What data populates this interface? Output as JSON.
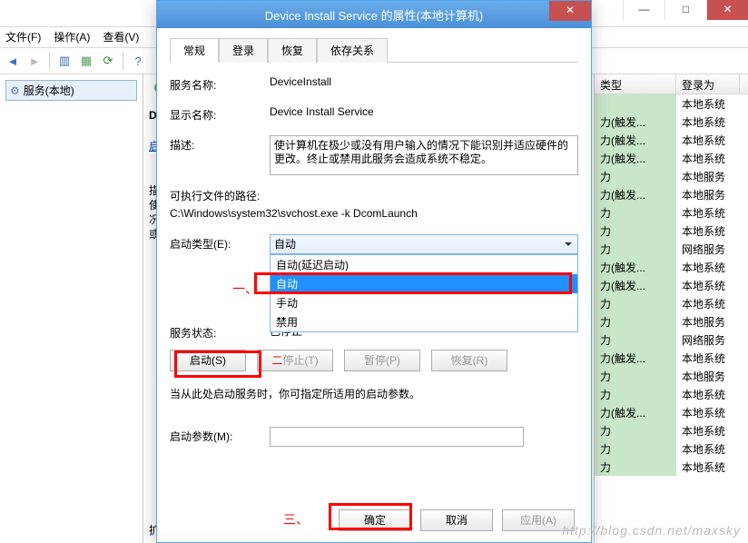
{
  "bg": {
    "menu": [
      "文件(F)",
      "操作(A)",
      "查看(V)"
    ],
    "tree_item": "服务(本地)",
    "detail": {
      "title_prefix": "Devi",
      "start_link": "启动",
      "desc_lines": [
        "描述:",
        "使计",
        "况下",
        "或禁"
      ],
      "tabs": "扩展"
    },
    "list_head": {
      "col1": "类型",
      "col2": "登录为"
    },
    "rows": [
      {
        "t": "",
        "a": "本地系统"
      },
      {
        "t": "力(触发...",
        "a": "本地系统"
      },
      {
        "t": "力(触发...",
        "a": "本地系统"
      },
      {
        "t": "力(触发...",
        "a": "本地系统"
      },
      {
        "t": "力",
        "a": "本地服务"
      },
      {
        "t": "力(触发...",
        "a": "本地服务"
      },
      {
        "t": "力",
        "a": "本地系统"
      },
      {
        "t": "力",
        "a": "本地系统"
      },
      {
        "t": "力",
        "a": "网络服务"
      },
      {
        "t": "力(触发...",
        "a": "本地系统"
      },
      {
        "t": "力(触发...",
        "a": "本地系统"
      },
      {
        "t": "力",
        "a": "本地系统"
      },
      {
        "t": "力",
        "a": "本地服务"
      },
      {
        "t": "力",
        "a": "网络服务"
      },
      {
        "t": "力(触发...",
        "a": "本地系统"
      },
      {
        "t": "力",
        "a": "本地服务"
      },
      {
        "t": "力",
        "a": "本地系统"
      },
      {
        "t": "力(触发...",
        "a": "本地系统"
      },
      {
        "t": "力",
        "a": "本地系统"
      },
      {
        "t": "力",
        "a": "本地系统"
      },
      {
        "t": "力",
        "a": "本地系统"
      }
    ]
  },
  "dlg": {
    "title": "Device Install Service 的属性(本地计算机)",
    "tabs": {
      "general": "常规",
      "logon": "登录",
      "recovery": "恢复",
      "deps": "依存关系"
    },
    "labels": {
      "svc_name": "服务名称:",
      "disp_name": "显示名称:",
      "desc": "描述:",
      "exe_path": "可执行文件的路径:",
      "startup": "启动类型(E):",
      "status": "服务状态:",
      "start_note": "当从此处启动服务时，你可指定所适用的启动参数。",
      "start_param": "启动参数(M):"
    },
    "vals": {
      "svc_name": "DeviceInstall",
      "disp_name": "Device Install Service",
      "desc": "使计算机在极少或没有用户输入的情况下能识别并适应硬件的更改。终止或禁用此服务会造成系统不稳定。",
      "exe_path": "C:\\Windows\\system32\\svchost.exe -k DcomLaunch",
      "startup_sel": "自动",
      "status": "已停止"
    },
    "startup_opts": {
      "o1": "自动(延迟启动)",
      "o2": "自动",
      "o3": "手动",
      "o4": "禁用"
    },
    "buttons": {
      "start": "启动(S)",
      "stop": "停止(T)",
      "pause": "暂停(P)",
      "resume": "恢复(R)",
      "ok": "确定",
      "cancel": "取消",
      "apply": "应用(A)"
    }
  },
  "annotations": {
    "one": "一、",
    "two": "二",
    "three": "三、"
  },
  "watermark": "http://blog.csdn.net/maxsky"
}
